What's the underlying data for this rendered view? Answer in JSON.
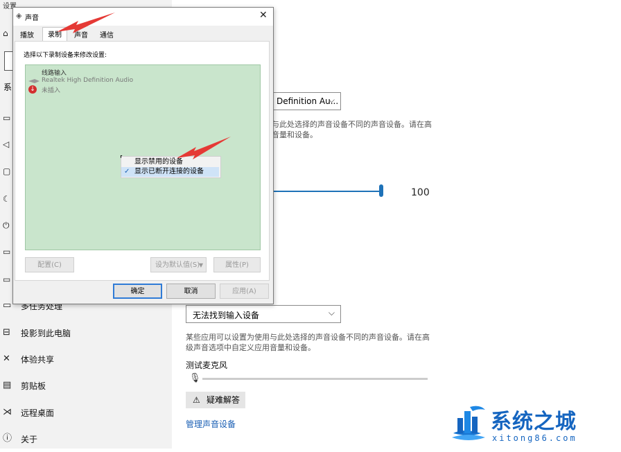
{
  "settings": {
    "top_title": "设置",
    "home_icon": "home-icon",
    "section_label": "系",
    "sidebar_items": [
      {
        "icon": "multitask-icon",
        "glyph": "▭",
        "label": "多任务处理"
      },
      {
        "icon": "project-icon",
        "glyph": "⊟",
        "label": "投影到此电脑"
      },
      {
        "icon": "share-icon",
        "glyph": "✕",
        "label": "体验共享"
      },
      {
        "icon": "clipboard-icon",
        "glyph": "▤",
        "label": "剪贴板"
      },
      {
        "icon": "remote-desktop-icon",
        "glyph": "⋊",
        "label": "远程桌面"
      },
      {
        "icon": "info-icon",
        "glyph": "ⓘ",
        "label": "关于"
      }
    ],
    "output_device_value": "Definition Au...",
    "output_desc_line1": "与此处选择的声音设备不同的声音设备。请在高",
    "output_desc_line2": "音量和设备。",
    "volume_value": "100",
    "volume_level": 100,
    "input_device_value": "无法找到输入设备",
    "input_desc_line1": "某些应用可以设置为使用与此处选择的声音设备不同的声音设备。请在高",
    "input_desc_line2": "级声音选项中自定义应用音量和设备。",
    "test_mic_label": "测试麦克风",
    "troubleshoot_label": "疑难解答",
    "manage_devices_link": "管理声音设备"
  },
  "dialog": {
    "title": "声音",
    "tabs": [
      "播放",
      "录制",
      "声音",
      "通信"
    ],
    "active_tab": 1,
    "instruction": "选择以下录制设备来修改设置:",
    "device": {
      "name": "线路输入",
      "driver": "Realtek High Definition Audio",
      "status": "未插入"
    },
    "context_menu": {
      "items": [
        {
          "label": "显示禁用的设备",
          "checked": false
        },
        {
          "label": "显示已断开连接的设备",
          "checked": true
        }
      ]
    },
    "configure_button": "配置(C)",
    "set_default_button": "设为默认值(S)",
    "properties_button": "属性(P)",
    "ok_button": "确定",
    "cancel_button": "取消",
    "apply_button": "应用(A)",
    "list_bg_color": "#c9e5cc"
  },
  "watermark": {
    "brand": "系统之城",
    "url": "xitong86.com"
  }
}
